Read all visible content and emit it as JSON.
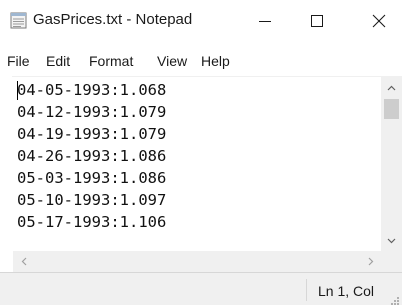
{
  "window": {
    "title": "GasPrices.txt - Notepad"
  },
  "menu": {
    "items": [
      "File",
      "Edit",
      "Format",
      "View",
      "Help"
    ]
  },
  "editor": {
    "lines": [
      "04-05-1993:1.068",
      "04-12-1993:1.079",
      "04-19-1993:1.079",
      "04-26-1993:1.086",
      "05-03-1993:1.086",
      "05-10-1993:1.097",
      "05-17-1993:1.106"
    ]
  },
  "status": {
    "position": "Ln 1, Col"
  },
  "colors": {
    "chrome": "#f0f0f0",
    "text": "#1a1a1a",
    "scroll_thumb": "#cdcdcd"
  }
}
